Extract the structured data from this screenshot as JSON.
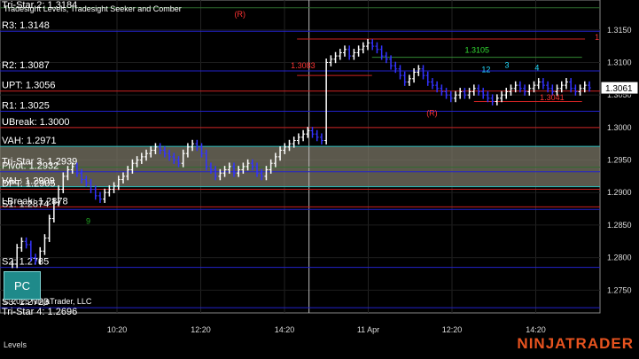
{
  "header": {
    "indicator_title": "Tradesight Levels, Tradesight Seeker and Comber"
  },
  "footer": {
    "copyright": "© 2025 NinjaTrader, LLC",
    "tab_label": "Levels",
    "brand": "NINJATRADER"
  },
  "pc_button": {
    "label": "PC"
  },
  "colors": {
    "background": "#000000",
    "up_bar": "#ffffff",
    "down_bar": "#3333ff",
    "pivot_line": "#2222cc",
    "break_line": "#cc2222",
    "value_zone": "#7a7566",
    "tristar_line": "#2e6b2e",
    "brand": "#e8531f"
  },
  "chart_data": {
    "type": "ohlc",
    "title": "",
    "xlabel": "",
    "ylabel": "",
    "ylim": [
      1.2715,
      1.3196
    ],
    "grid": true,
    "x_ticks": [
      "10:20",
      "12:20",
      "14:20",
      "11 Apr",
      "12:20",
      "14:20"
    ],
    "y_ticks": [
      1.275,
      1.28,
      1.285,
      1.29,
      1.295,
      1.3,
      1.305,
      1.31,
      1.315
    ],
    "current_price": {
      "label": "1.3061",
      "value": 1.3061
    },
    "levels": [
      {
        "label": "Tri-Star 2: 1.3184",
        "value": 1.3184,
        "kind": "tristar"
      },
      {
        "label": "R3: 1.3148",
        "value": 1.3148,
        "kind": "pivot"
      },
      {
        "label": "R2: 1.3087",
        "value": 1.3087,
        "kind": "pivot"
      },
      {
        "label": "UPT: 1.3056",
        "value": 1.3056,
        "kind": "break"
      },
      {
        "label": "R1: 1.3025",
        "value": 1.3025,
        "kind": "pivot"
      },
      {
        "label": "UBreak: 1.3000",
        "value": 1.3,
        "kind": "break"
      },
      {
        "label": "VAH: 1.2971",
        "value": 1.2971,
        "kind": "value"
      },
      {
        "label": "Tri-Star 3: 1.2939",
        "value": 1.2939,
        "kind": "tristar"
      },
      {
        "label": "Pivot: 1.2932",
        "value": 1.2932,
        "kind": "pivot"
      },
      {
        "label": "VAL: 1.2909",
        "value": 1.2909,
        "kind": "value"
      },
      {
        "label": "DPT: 1.2905",
        "value": 1.2905,
        "kind": "break"
      },
      {
        "label": "LBreak: 1.2878",
        "value": 1.2878,
        "kind": "break"
      },
      {
        "label": "S1: 1.2874",
        "value": 1.2874,
        "kind": "pivot"
      },
      {
        "label": "S2: 1.2785",
        "value": 1.2785,
        "kind": "pivot"
      },
      {
        "label": "S3: 1.2723",
        "value": 1.2723,
        "kind": "pivot"
      },
      {
        "label": "Tri-Star 4: 1.2696",
        "value": 1.2696,
        "kind": "tristar"
      }
    ],
    "annotations": [
      {
        "text": "(R)",
        "x": 0.4,
        "y": 1.317,
        "color": "#ff3333"
      },
      {
        "text": "(R)",
        "x": 0.72,
        "y": 1.3018,
        "color": "#ff3333"
      },
      {
        "text": "1.3083",
        "x": 0.505,
        "y": 1.3091,
        "color": "#ff3333"
      },
      {
        "text": "1.3041",
        "x": 0.92,
        "y": 1.3042,
        "color": "#ff3333"
      },
      {
        "text": "1.3105",
        "x": 0.795,
        "y": 1.3115,
        "color": "#33dd33"
      },
      {
        "text": "1",
        "x": 0.995,
        "y": 1.3135,
        "color": "#ff3333"
      },
      {
        "text": "12",
        "x": 0.81,
        "y": 1.3085,
        "color": "#22ddff"
      },
      {
        "text": "3",
        "x": 0.845,
        "y": 1.3092,
        "color": "#22ddff"
      },
      {
        "text": "4",
        "x": 0.895,
        "y": 1.3088,
        "color": "#22ddff"
      },
      {
        "text": "9",
        "x": 0.147,
        "y": 1.2852,
        "color": "#22aa22"
      }
    ],
    "segments": [
      {
        "x1": 0.495,
        "x2": 0.975,
        "y": 1.3136,
        "color": "#cc2222"
      },
      {
        "x1": 0.495,
        "x2": 0.62,
        "y": 1.308,
        "color": "#cc2222"
      },
      {
        "x1": 0.62,
        "x2": 0.97,
        "y": 1.3108,
        "color": "#338833"
      },
      {
        "x1": 0.79,
        "x2": 0.97,
        "y": 1.304,
        "color": "#cc2222"
      }
    ],
    "session_divider_x": 0.515,
    "series": [
      {
        "name": "Price",
        "values": [
          1.279,
          1.2815,
          1.2825,
          1.282,
          1.28,
          1.2795,
          1.281,
          1.283,
          1.286,
          1.2885,
          1.2905,
          1.2925,
          1.2935,
          1.294,
          1.293,
          1.292,
          1.2915,
          1.2905,
          1.2895,
          1.289,
          1.29,
          1.2905,
          1.291,
          1.292,
          1.2925,
          1.2935,
          1.2945,
          1.295,
          1.2955,
          1.296,
          1.2965,
          1.297,
          1.2965,
          1.296,
          1.2955,
          1.295,
          1.2945,
          1.296,
          1.297,
          1.2975,
          1.297,
          1.296,
          1.294,
          1.2935,
          1.2925,
          1.293,
          1.2935,
          1.294,
          1.293,
          1.2935,
          1.294,
          1.2945,
          1.294,
          1.293,
          1.2925,
          1.2935,
          1.2945,
          1.2955,
          1.2965,
          1.297,
          1.2975,
          1.298,
          1.2985,
          1.299,
          1.2995,
          1.299,
          1.2985,
          1.298,
          1.31,
          1.3105,
          1.311,
          1.3115,
          1.312,
          1.311,
          1.3115,
          1.312,
          1.3125,
          1.313,
          1.3125,
          1.312,
          1.311,
          1.3105,
          1.3095,
          1.309,
          1.308,
          1.307,
          1.3075,
          1.3085,
          1.309,
          1.308,
          1.307,
          1.3065,
          1.306,
          1.3055,
          1.305,
          1.3045,
          1.305,
          1.3055,
          1.305,
          1.3055,
          1.306,
          1.3055,
          1.305,
          1.3045,
          1.304,
          1.3045,
          1.305,
          1.3055,
          1.306,
          1.3065,
          1.306,
          1.3055,
          1.306,
          1.3065,
          1.307,
          1.3065,
          1.306,
          1.3055,
          1.306,
          1.3065,
          1.307,
          1.306,
          1.3055,
          1.306,
          1.3065,
          1.3061
        ]
      }
    ]
  }
}
